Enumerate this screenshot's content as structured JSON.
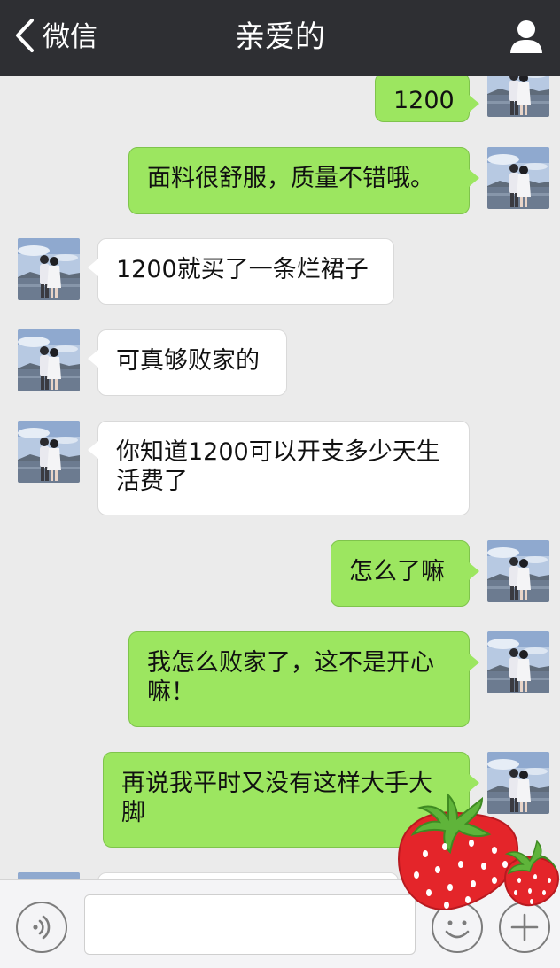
{
  "navbar": {
    "back_label": "微信",
    "title": "亲爱的",
    "back_icon": "chevron-left-icon",
    "profile_icon": "person-icon"
  },
  "messages": [
    {
      "side": "me",
      "lines": [
        "1200"
      ]
    },
    {
      "side": "me",
      "lines": [
        "面料很舒服，质量不错哦。"
      ]
    },
    {
      "side": "them",
      "lines": [
        "1200就买了一条烂裙子"
      ]
    },
    {
      "side": "them",
      "lines": [
        "可真够败家的"
      ]
    },
    {
      "side": "them",
      "lines": [
        "你知道1200可以开支多少天生",
        "活费了"
      ]
    },
    {
      "side": "me",
      "lines": [
        "怎么了嘛"
      ]
    },
    {
      "side": "me",
      "lines": [
        "我怎么败家了，这不是开心",
        "嘛！"
      ]
    },
    {
      "side": "me",
      "lines": [
        "再说我平时又没有这样大手大",
        "脚"
      ]
    }
  ],
  "inputbar": {
    "voice_icon": "voice-icon",
    "emoji_icon": "emoji-icon",
    "plus_icon": "plus-icon",
    "text_value": ""
  },
  "colors": {
    "navbar": "#2e2f33",
    "background": "#ebebeb",
    "my_bubble": "#9ce660",
    "their_bubble": "#ffffff"
  }
}
